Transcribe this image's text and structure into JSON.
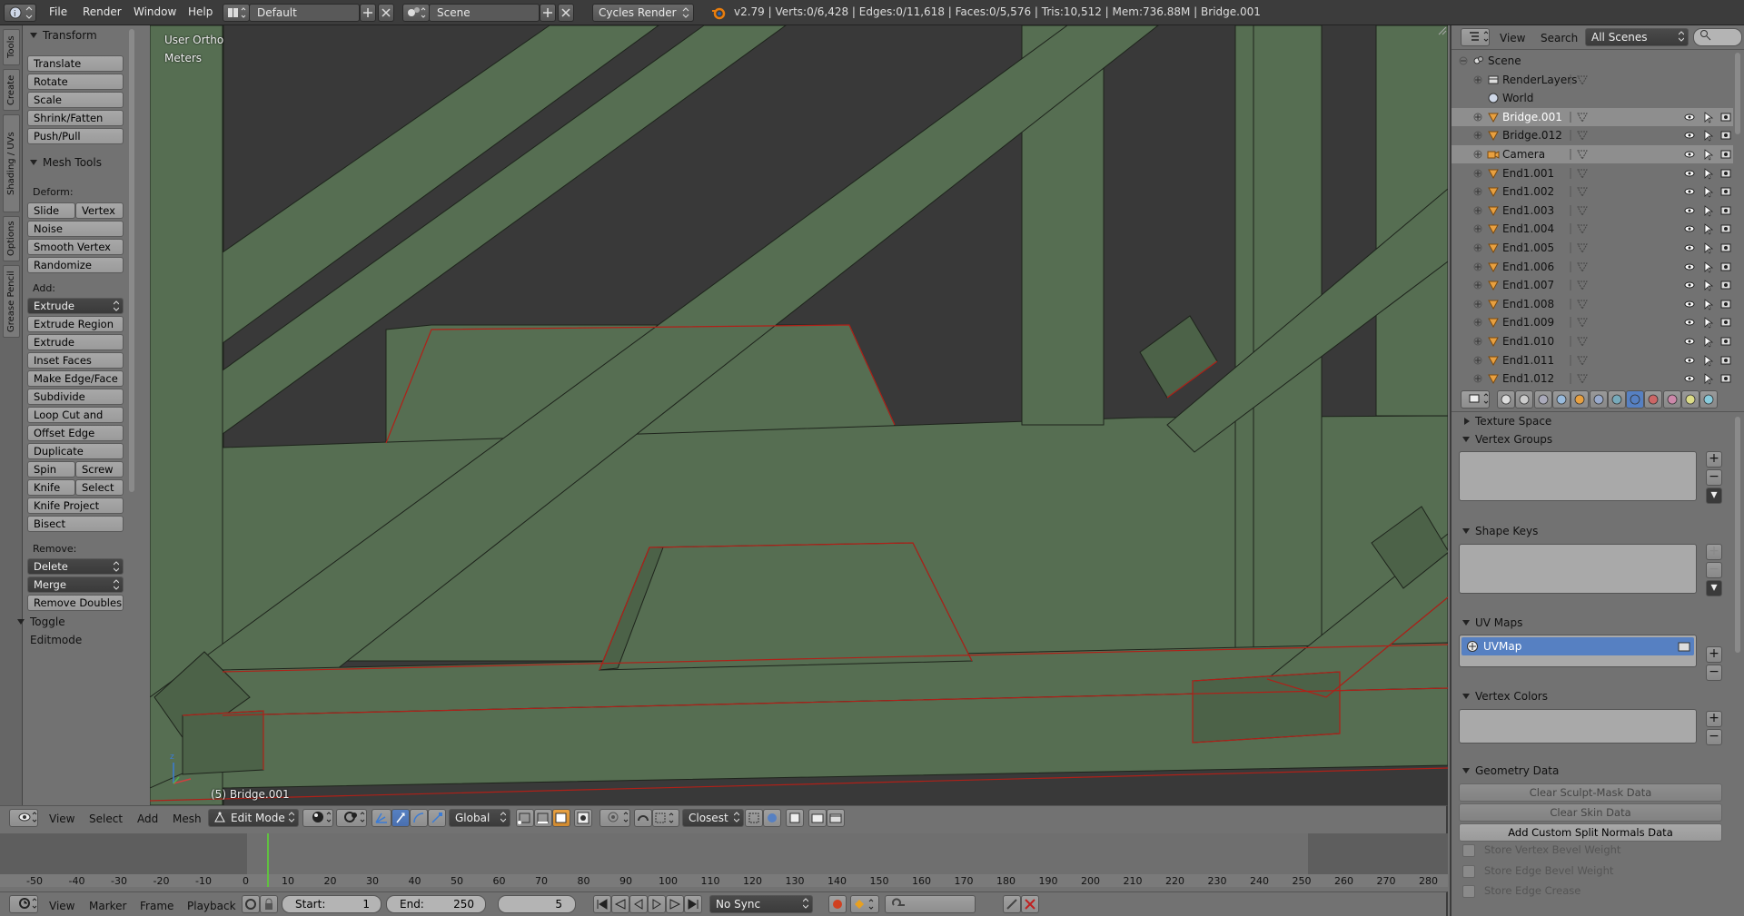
{
  "topbar": {
    "menus": [
      "File",
      "Render",
      "Window",
      "Help"
    ],
    "screen_layout": "Default",
    "scene": "Scene",
    "render_engine": "Cycles Render",
    "stats": "v2.79 | Verts:0/6,428 | Edges:0/11,618 | Faces:0/5,576 | Tris:10,512 | Mem:736.88M | Bridge.001"
  },
  "tool_tabs": [
    "Tools",
    "Create",
    "Shading / UVs",
    "Options",
    "Grease Pencil"
  ],
  "toolshelf": {
    "transform_title": "Transform",
    "transform_buttons": [
      "Translate",
      "Rotate",
      "Scale",
      "Shrink/Fatten",
      "Push/Pull"
    ],
    "mesh_tools_title": "Mesh Tools",
    "deform_label": "Deform:",
    "slide_edge": "Slide Ed",
    "vertex": "Vertex",
    "noise": "Noise",
    "smooth_vertex": "Smooth Vertex",
    "randomize": "Randomize",
    "add_label": "Add:",
    "extrude": "Extrude",
    "add_buttons": [
      "Extrude Region",
      "Extrude Individual",
      "Inset Faces",
      "Make Edge/Face",
      "Subdivide",
      "Loop Cut and Slide",
      "Offset Edge Slide",
      "Duplicate"
    ],
    "spin": "Spin",
    "screw": "Screw",
    "knife": "Knife",
    "select": "Select",
    "knife_project": "Knife Project",
    "bisect": "Bisect",
    "remove_label": "Remove:",
    "delete": "Delete",
    "merge": "Merge",
    "remove_doubles": "Remove Doubles",
    "toggle_editmode": "Toggle Editmode"
  },
  "viewport": {
    "view_name": "User Ortho",
    "units": "Meters",
    "object_label": "(5) Bridge.001"
  },
  "viewport_header": {
    "menus": [
      "View",
      "Select",
      "Add",
      "Mesh"
    ],
    "mode": "Edit Mode",
    "orientation": "Global",
    "snap_target": "Closest"
  },
  "timeline": {
    "ticks": [
      "-50",
      "-40",
      "-30",
      "-20",
      "-10",
      "0",
      "10",
      "20",
      "30",
      "40",
      "50",
      "60",
      "70",
      "80",
      "90",
      "100",
      "110",
      "120",
      "130",
      "140",
      "150",
      "160",
      "170",
      "180",
      "190",
      "200",
      "210",
      "220",
      "230",
      "240",
      "250",
      "260",
      "270",
      "280"
    ],
    "current_frame": 5,
    "menus": [
      "View",
      "Marker",
      "Frame",
      "Playback"
    ],
    "start_label": "Start:",
    "start": "1",
    "end_label": "End:",
    "end": "250",
    "frame": "5",
    "sync": "No Sync"
  },
  "outliner": {
    "menus": [
      "View",
      "Search"
    ],
    "filter": "All Scenes",
    "rows": [
      {
        "label": "Scene",
        "level": 0,
        "type": "scene"
      },
      {
        "label": "RenderLayers",
        "level": 1,
        "type": "renderlayers"
      },
      {
        "label": "World",
        "level": 1,
        "type": "world"
      },
      {
        "label": "Bridge.001",
        "level": 1,
        "type": "mesh",
        "active": true
      },
      {
        "label": "Bridge.012",
        "level": 1,
        "type": "mesh"
      },
      {
        "label": "Camera",
        "level": 1,
        "type": "camera",
        "selected": true
      },
      {
        "label": "End1.001",
        "level": 1,
        "type": "mesh"
      },
      {
        "label": "End1.002",
        "level": 1,
        "type": "mesh"
      },
      {
        "label": "End1.003",
        "level": 1,
        "type": "mesh"
      },
      {
        "label": "End1.004",
        "level": 1,
        "type": "mesh"
      },
      {
        "label": "End1.005",
        "level": 1,
        "type": "mesh"
      },
      {
        "label": "End1.006",
        "level": 1,
        "type": "mesh"
      },
      {
        "label": "End1.007",
        "level": 1,
        "type": "mesh"
      },
      {
        "label": "End1.008",
        "level": 1,
        "type": "mesh"
      },
      {
        "label": "End1.009",
        "level": 1,
        "type": "mesh"
      },
      {
        "label": "End1.010",
        "level": 1,
        "type": "mesh"
      },
      {
        "label": "End1.011",
        "level": 1,
        "type": "mesh"
      },
      {
        "label": "End1.012",
        "level": 1,
        "type": "mesh"
      }
    ]
  },
  "properties": {
    "texture_space": "Texture Space",
    "vertex_groups": "Vertex Groups",
    "shape_keys": "Shape Keys",
    "uv_maps": "UV Maps",
    "uv_map_name": "UVMap",
    "vertex_colors": "Vertex Colors",
    "geometry_data": "Geometry Data",
    "clear_sculpt_mask": "Clear Sculpt-Mask Data",
    "clear_skin": "Clear Skin Data",
    "add_custom_split_normals": "Add Custom Split Normals Data",
    "store_vertex_bevel": "Store Vertex Bevel Weight",
    "store_edge_bevel": "Store Edge Bevel Weight",
    "store_edge_crease": "Store Edge Crease"
  },
  "colors": {
    "mesh_face": "#566e52",
    "mesh_edge": "#1e241c",
    "mesh_seam": "#b02018",
    "selection_blue": "#5680c2",
    "current_frame": "#60c040"
  }
}
